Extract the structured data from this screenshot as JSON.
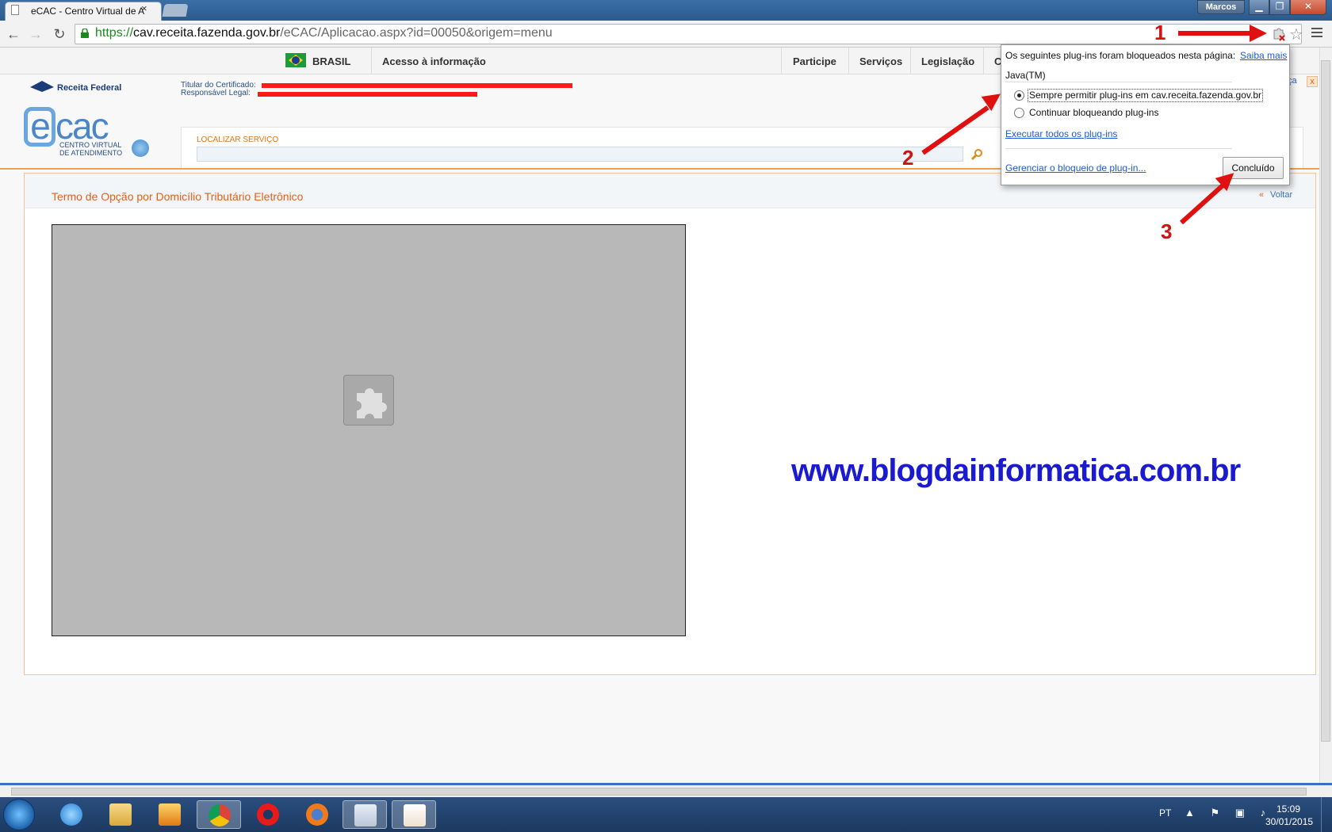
{
  "browser": {
    "tab_title": "eCAC - Centro Virtual de A",
    "tab_close": "×",
    "user_name": "Marcos",
    "window_controls": {
      "minimize": "▁",
      "maximize": "❐",
      "close": "✕"
    },
    "url_scheme": "https://",
    "url_host": "cav.receita.fazenda.gov.br",
    "url_path": "/eCAC/Aplicacao.aspx?id=00050&origem=menu",
    "star_icon": "☆"
  },
  "govbar": {
    "country": "BRASIL",
    "access_info": "Acesso à informação",
    "links": [
      "Participe",
      "Serviços",
      "Legislação",
      "C"
    ]
  },
  "ecac_header": {
    "rf_logo": "Receita Federal",
    "cert_holder_label": "Titular do Certificado:",
    "legal_resp_label": "Responsável Legal:",
    "ecac_rest": "cac",
    "ecac_sub_line1": "CENTRO VIRTUAL",
    "ecac_sub_line2": "DE ATENDIMENTO",
    "search_label": "LOCALIZAR SERVIÇO",
    "partial_link": "ça",
    "close_icon": "x"
  },
  "content": {
    "title": "Termo de Opção por Domicílio Tributário Eletrônico",
    "back_label": "Voltar",
    "back_icon": "«",
    "watermark": "www.blogdainformatica.com.br"
  },
  "popup": {
    "header": "Os seguintes plug-ins foram bloqueados nesta página:",
    "learn_more": "Saiba mais",
    "plugin_name": "Java(TM)",
    "option_allow": "Sempre permitir plug-ins em cav.receita.fazenda.gov.br",
    "option_block": "Continuar bloqueando plug-ins",
    "run_all": "Executar todos os plug-ins",
    "manage": "Gerenciar o bloqueio de plug-in...",
    "done": "Concluído",
    "selected_option": "allow"
  },
  "annotations": [
    "1",
    "2",
    "3"
  ],
  "taskbar": {
    "lang": "PT",
    "time": "15:09",
    "date": "30/01/2015",
    "apps": [
      "internet-explorer",
      "file-explorer",
      "media-player",
      "chrome",
      "opera",
      "firefox",
      "windows-explorer",
      "java"
    ]
  },
  "colors": {
    "accent_orange": "#e0621b",
    "link_blue": "#1a5bd6",
    "annotation_red": "#e01010",
    "watermark_blue": "#1a1ad0"
  }
}
